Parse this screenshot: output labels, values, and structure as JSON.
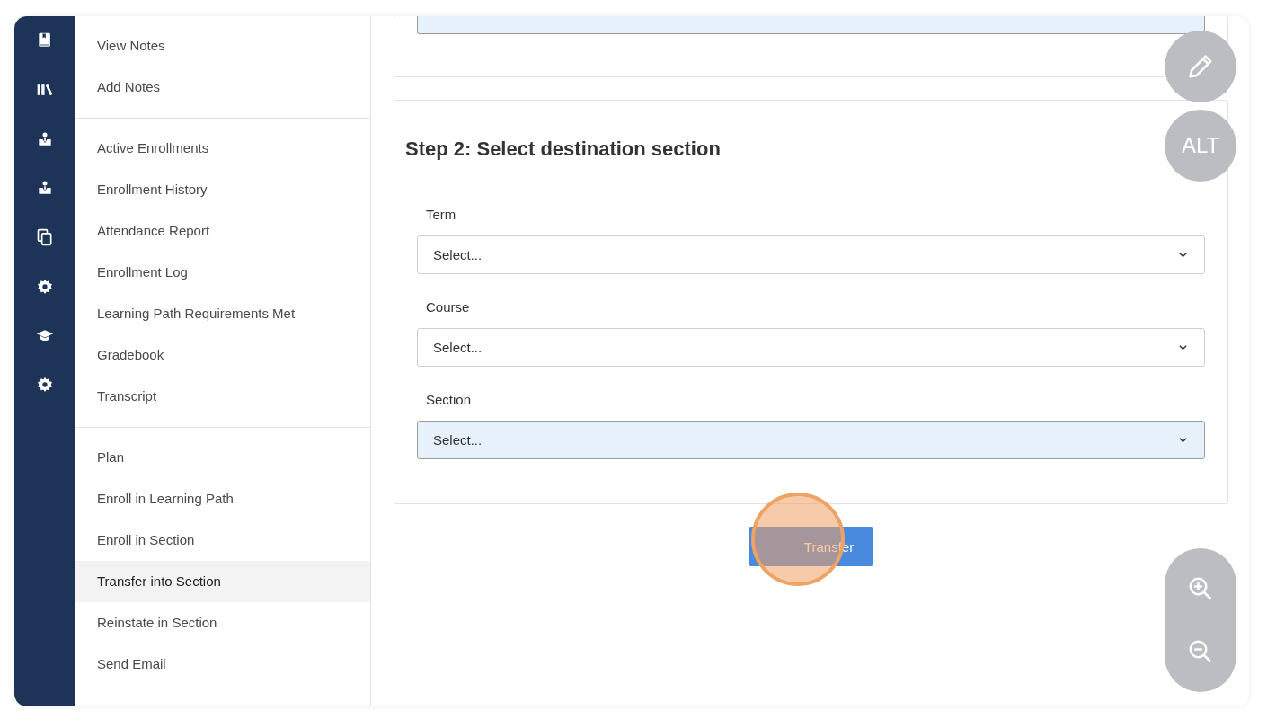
{
  "rail_icons": [
    {
      "kind": "book"
    },
    {
      "kind": "library"
    },
    {
      "kind": "person"
    },
    {
      "kind": "person"
    },
    {
      "kind": "copy"
    },
    {
      "kind": "gear"
    },
    {
      "kind": "cap"
    },
    {
      "kind": "gear"
    }
  ],
  "menu": {
    "groups": [
      {
        "items": [
          {
            "label": "View Notes",
            "selected": false
          },
          {
            "label": "Add Notes",
            "selected": false
          }
        ]
      },
      {
        "items": [
          {
            "label": "Active Enrollments",
            "selected": false
          },
          {
            "label": "Enrollment History",
            "selected": false
          },
          {
            "label": "Attendance Report",
            "selected": false
          },
          {
            "label": "Enrollment Log",
            "selected": false
          },
          {
            "label": "Learning Path Requirements Met",
            "selected": false
          },
          {
            "label": "Gradebook",
            "selected": false
          },
          {
            "label": "Transcript",
            "selected": false
          }
        ]
      },
      {
        "items": [
          {
            "label": "Plan",
            "selected": false
          },
          {
            "label": "Enroll in Learning Path",
            "selected": false
          },
          {
            "label": "Enroll in Section",
            "selected": false
          },
          {
            "label": "Transfer into Section",
            "selected": true
          },
          {
            "label": "Reinstate in Section",
            "selected": false
          },
          {
            "label": "Send Email",
            "selected": false
          }
        ]
      }
    ]
  },
  "step2": {
    "title": "Step 2: Select destination section",
    "fields": [
      {
        "label": "Term",
        "value": "Select...",
        "focused": false
      },
      {
        "label": "Course",
        "value": "Select...",
        "focused": false
      },
      {
        "label": "Section",
        "value": "Select...",
        "focused": true
      }
    ]
  },
  "transfer_button": {
    "label": "Transfer"
  },
  "floating": {
    "alt_label": "ALT"
  }
}
